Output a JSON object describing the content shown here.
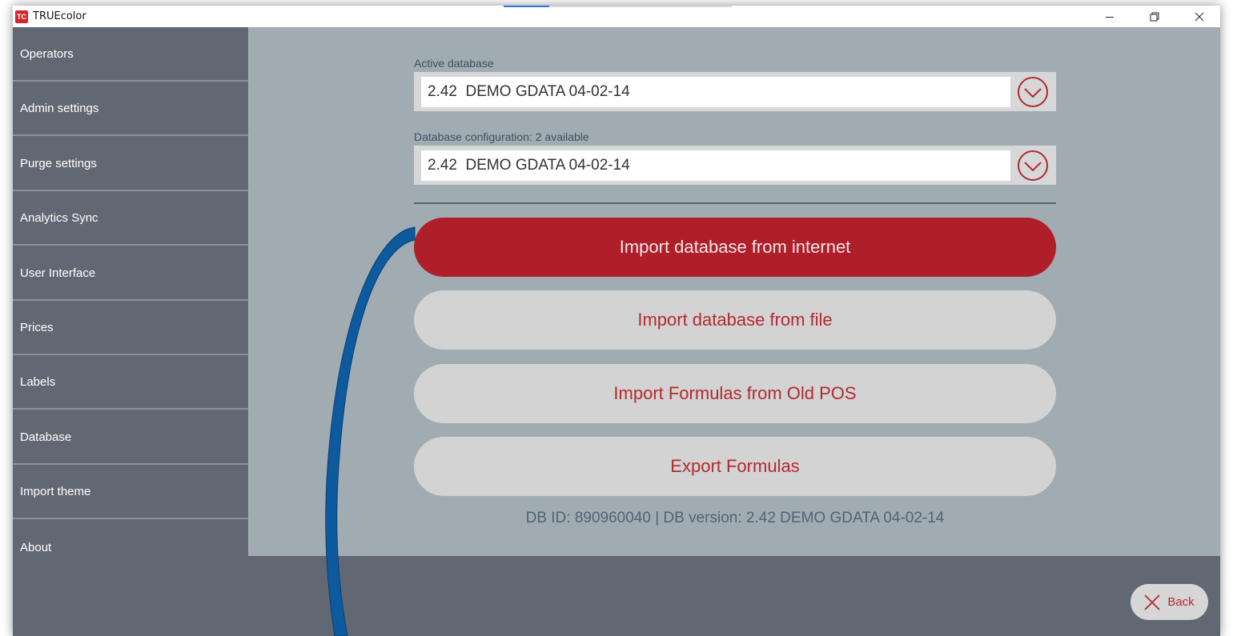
{
  "window": {
    "title": "TRUEcolor",
    "logo_text": "TC"
  },
  "sidebar": {
    "items": [
      {
        "label": "Operators"
      },
      {
        "label": "Admin settings"
      },
      {
        "label": "Purge settings"
      },
      {
        "label": "Analytics Sync"
      },
      {
        "label": "User Interface"
      },
      {
        "label": "Prices"
      },
      {
        "label": "Labels"
      },
      {
        "label": "Database"
      },
      {
        "label": "Import theme"
      },
      {
        "label": "About"
      }
    ]
  },
  "main": {
    "active_database": {
      "label": "Active database",
      "value": "2.42  DEMO GDATA 04-02-14"
    },
    "database_configuration": {
      "label": "Database configuration: 2 available",
      "value": "2.42  DEMO GDATA 04-02-14"
    },
    "buttons": {
      "import_internet": "Import database from internet",
      "import_file": "Import database from file",
      "import_formulas": "Import Formulas from Old POS",
      "export_formulas": "Export Formulas"
    },
    "db_info": "DB ID: 890960040 | DB version: 2.42  DEMO GDATA 04-02-14"
  },
  "footer": {
    "back_label": "Back"
  },
  "colors": {
    "accent_red": "#af1f29",
    "sidebar_bg": "#626873",
    "content_bg": "#a1acb2",
    "annotation_blue": "#0d5a9e"
  },
  "icons": {
    "dropdown": "chevron-down-circle-icon",
    "back": "close-x-icon"
  }
}
